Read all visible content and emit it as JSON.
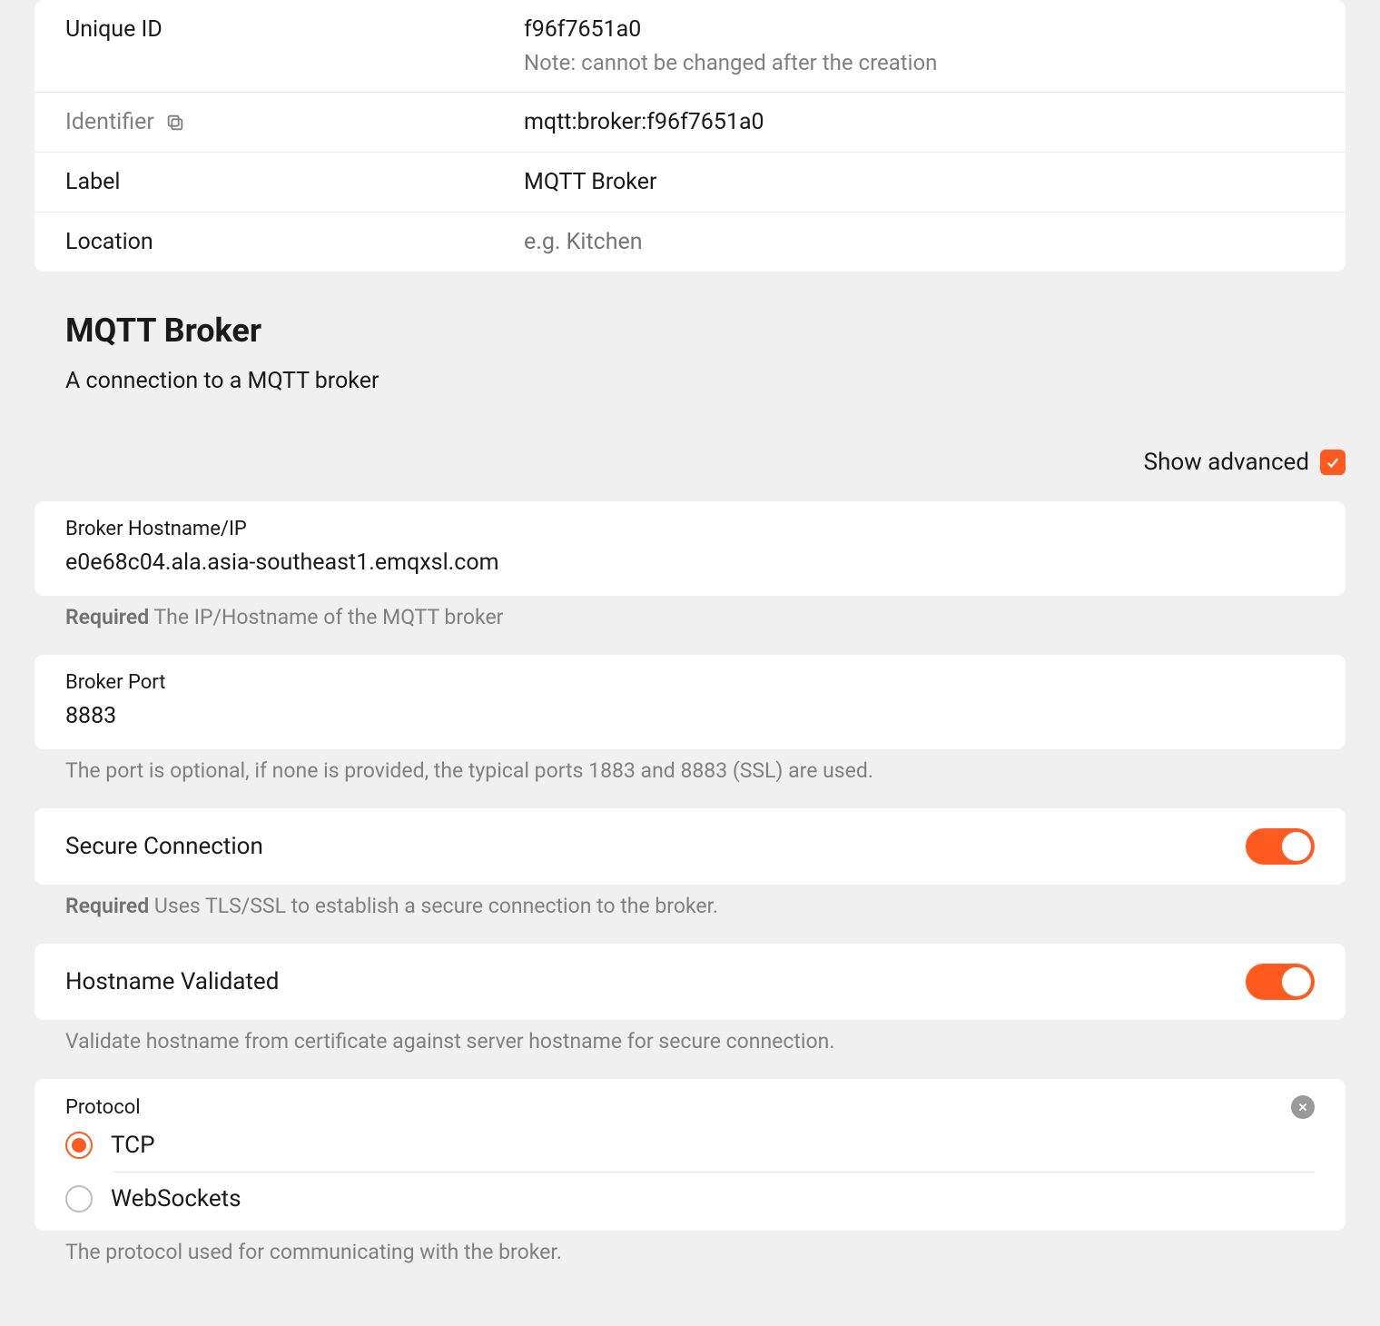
{
  "info": {
    "unique_id_label": "Unique ID",
    "unique_id_value": "f96f7651a0",
    "unique_id_note": "Note: cannot be changed after the creation",
    "identifier_label": "Identifier",
    "identifier_value": "mqtt:broker:f96f7651a0",
    "label_label": "Label",
    "label_value": "MQTT Broker",
    "location_label": "Location",
    "location_placeholder": "e.g. Kitchen"
  },
  "section": {
    "title": "MQTT Broker",
    "description": "A connection to a MQTT broker"
  },
  "advanced": {
    "label": "Show advanced",
    "checked": true
  },
  "fields": {
    "hostname": {
      "label": "Broker Hostname/IP",
      "value": "e0e68c04.ala.asia-southeast1.emqxsl.com",
      "required_prefix": "Required",
      "helper": "The IP/Hostname of the MQTT broker"
    },
    "port": {
      "label": "Broker Port",
      "value": "8883",
      "helper": "The port is optional, if none is provided, the typical ports 1883 and 8883 (SSL) are used."
    },
    "secure": {
      "label": "Secure Connection",
      "on": true,
      "required_prefix": "Required",
      "helper": "Uses TLS/SSL to establish a secure connection to the broker."
    },
    "hostname_validated": {
      "label": "Hostname Validated",
      "on": true,
      "helper": "Validate hostname from certificate against server hostname for secure connection."
    },
    "protocol": {
      "label": "Protocol",
      "options": [
        "TCP",
        "WebSockets"
      ],
      "selected": "TCP",
      "helper": "The protocol used for communicating with the broker."
    }
  }
}
